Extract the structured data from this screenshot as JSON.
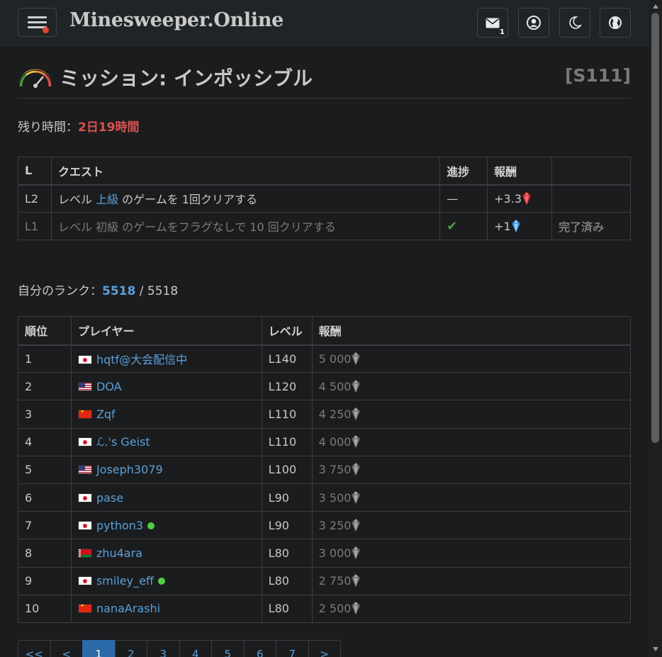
{
  "nav": {
    "brand": "Minesweeper.Online",
    "mail_count": "1",
    "icons": [
      "menu-icon",
      "mail-icon",
      "user-icon",
      "moon-icon",
      "globe-icon"
    ]
  },
  "mission": {
    "title": "ミッション: インポッシブル",
    "code": "[S111]",
    "time_label": "残り時間：",
    "time_value": "2日19時間"
  },
  "quests": {
    "headers": [
      "L",
      "クエスト",
      "進捗",
      "報酬",
      ""
    ],
    "rows": [
      {
        "level": "L2",
        "text_pre": "レベル ",
        "text_link": "上級",
        "text_post": " のゲームを 1回クリアする",
        "progress": "—",
        "reward": "+3.3",
        "reward_gem": "red",
        "status": ""
      },
      {
        "level": "L1",
        "text_pre": "レベル ",
        "text_link": "初級",
        "text_post": " のゲームをフラグなしで 10 回クリアする",
        "progress": "✔",
        "reward": "+1",
        "reward_gem": "blue",
        "status": "完了済み"
      }
    ]
  },
  "rank": {
    "label": "自分のランク：",
    "mine": "5518",
    "separator": " / ",
    "total": "5518"
  },
  "leaderboard": {
    "headers": [
      "順位",
      "プレイヤー",
      "レベル",
      "報酬"
    ],
    "rows": [
      {
        "rank": "1",
        "flag": "jp",
        "player": "hqtf@大会配信中",
        "online": false,
        "level": "L140",
        "reward": "5 000"
      },
      {
        "rank": "2",
        "flag": "us",
        "player": "DOA",
        "online": false,
        "level": "L120",
        "reward": "4 500"
      },
      {
        "rank": "3",
        "flag": "cn",
        "player": "Zqf",
        "online": false,
        "level": "L110",
        "reward": "4 250"
      },
      {
        "rank": "4",
        "flag": "jp",
        "player": "ℒ.'s Geist",
        "online": false,
        "level": "L110",
        "reward": "4 000"
      },
      {
        "rank": "5",
        "flag": "us",
        "player": "Joseph3079",
        "online": false,
        "level": "L100",
        "reward": "3 750"
      },
      {
        "rank": "6",
        "flag": "jp",
        "player": "pase",
        "online": false,
        "level": "L90",
        "reward": "3 500"
      },
      {
        "rank": "7",
        "flag": "jp",
        "player": "python3",
        "online": true,
        "level": "L90",
        "reward": "3 250"
      },
      {
        "rank": "8",
        "flag": "by",
        "player": "zhu4ara",
        "online": false,
        "level": "L80",
        "reward": "3 000"
      },
      {
        "rank": "9",
        "flag": "jp",
        "player": "smiley_eff",
        "online": true,
        "level": "L80",
        "reward": "2 750"
      },
      {
        "rank": "10",
        "flag": "cn",
        "player": "nanaArashi",
        "online": false,
        "level": "L80",
        "reward": "2 500"
      }
    ]
  },
  "pagination": {
    "items": [
      "<<",
      "<",
      "1",
      "2",
      "3",
      "4",
      "5",
      "6",
      "7",
      ">"
    ],
    "active": "1"
  },
  "colors": {
    "accent_link": "#5aa0d8",
    "time_red": "#d9534f",
    "online_green": "#4cd040",
    "active_page": "#2a6aa8"
  }
}
